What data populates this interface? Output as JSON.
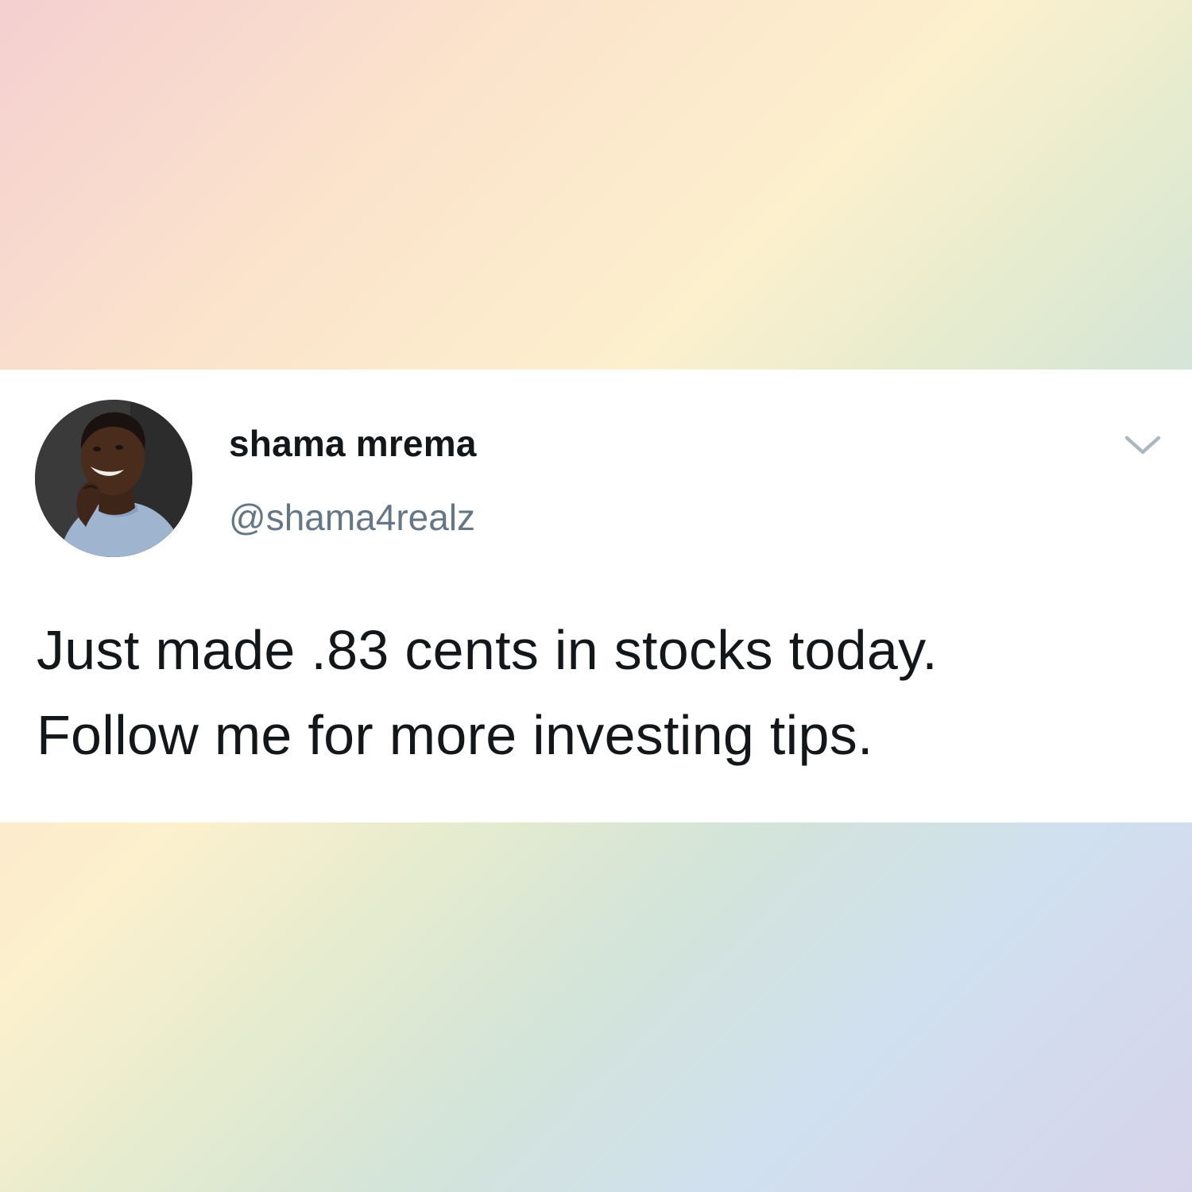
{
  "tweet": {
    "display_name": "shama mrema",
    "handle": "@shama4realz",
    "text_lines": [
      "Just made .83 cents in stocks today.",
      "Follow me for more investing tips."
    ],
    "avatar": "profile-photo",
    "menu_icon": "chevron-down-icon"
  },
  "colors": {
    "card_background": "#ffffff",
    "name_color": "#14171a",
    "handle_color": "#657786",
    "chevron_color": "#aab8c2",
    "gradient": [
      "#f4cfd0",
      "#fbe3cc",
      "#fcf0cd",
      "#d3e4d8",
      "#d0e0ef",
      "#d6d4ea"
    ]
  }
}
